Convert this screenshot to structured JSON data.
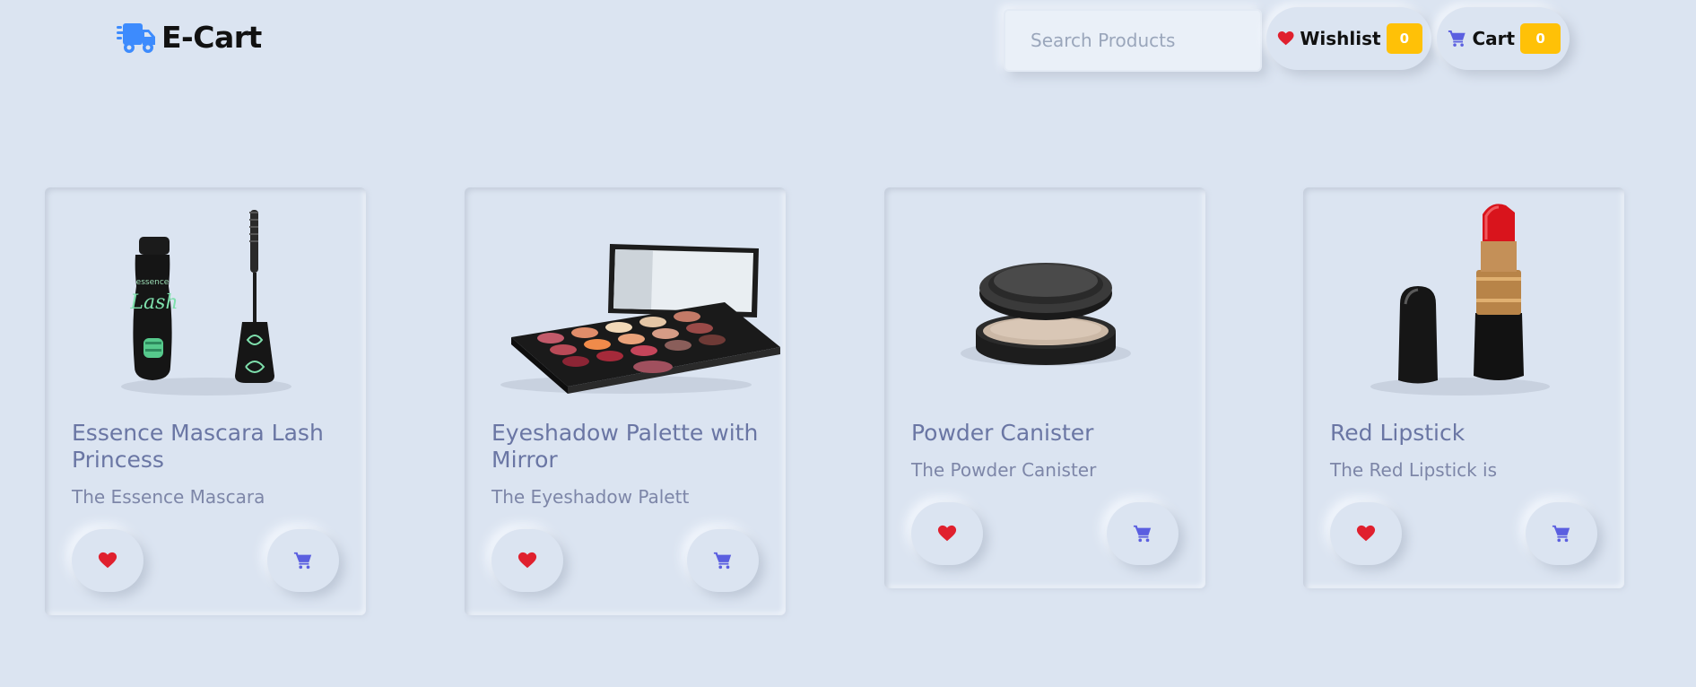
{
  "brand": {
    "name": "E-Cart",
    "icon": "truck-fast-icon"
  },
  "search": {
    "placeholder": "Search Products",
    "value": ""
  },
  "nav": {
    "wishlist": {
      "label": "Wishlist",
      "count": "0",
      "icon": "heart-icon"
    },
    "cart": {
      "label": "Cart",
      "count": "0",
      "icon": "cart-icon"
    }
  },
  "colors": {
    "background": "#dbe4f1",
    "brand_icon": "#3d8bfd",
    "heart": "#e0202e",
    "cart": "#5b5fe0",
    "badge": "#ffc107",
    "title": "#6a76a4"
  },
  "products": [
    {
      "title": "Essence Mascara Lash Princess",
      "description": "The Essence Mascara",
      "image": "mascara"
    },
    {
      "title": "Eyeshadow Palette with Mirror",
      "description": "The Eyeshadow Palett",
      "image": "eyeshadow-palette"
    },
    {
      "title": "Powder Canister",
      "description": "The Powder Canister",
      "image": "powder-canister"
    },
    {
      "title": "Red Lipstick",
      "description": "The Red Lipstick is",
      "image": "red-lipstick"
    }
  ]
}
